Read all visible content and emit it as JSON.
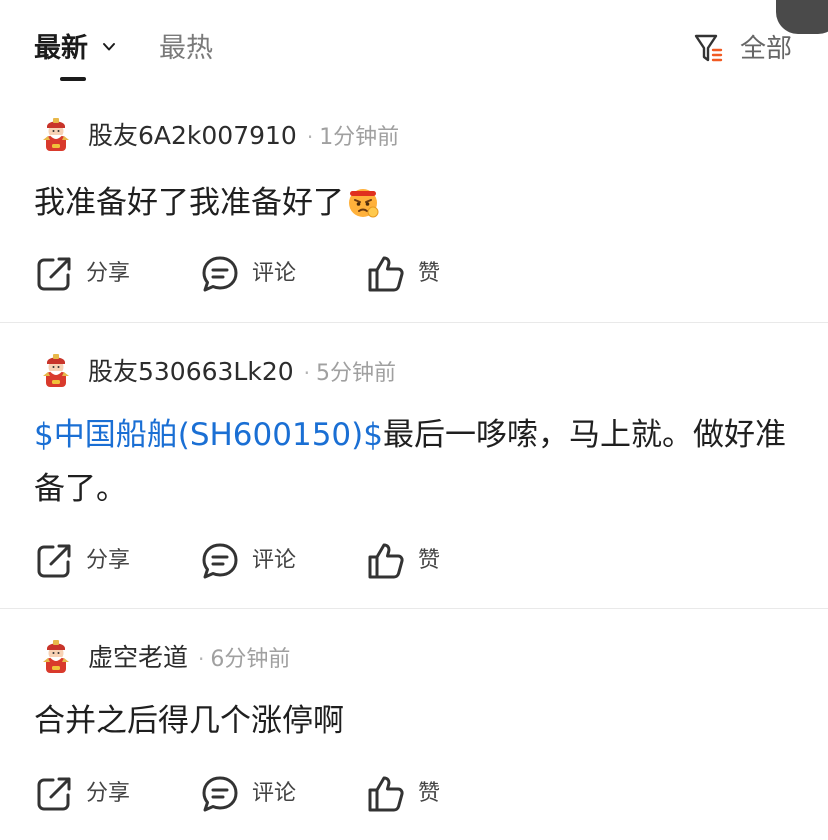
{
  "tabs": {
    "latest": "最新",
    "hot": "最热",
    "filter_label": "全部"
  },
  "icons": {
    "chevron": "chevron-down-icon",
    "filter": "filter-icon",
    "share": "share-icon",
    "comment": "comment-icon",
    "like": "thumbs-up-icon",
    "avatar": "god-of-wealth-avatar",
    "emoji": "angry-face-emoji"
  },
  "colors": {
    "link": "#1a6fd4",
    "filter_accent": "#f15a22"
  },
  "posts": [
    {
      "username": "股友6A2k007910",
      "time": "1分钟前",
      "text": "我准备好了我准备好了"
    },
    {
      "username": "股友530663Lk20",
      "time": "5分钟前",
      "stock_link": "$中国船舶(SH600150)$",
      "text": "最后一哆嗦，马上就。做好准备了。"
    },
    {
      "username": "虚空老道",
      "time": "6分钟前",
      "text": "合并之后得几个涨停啊"
    }
  ],
  "actions": {
    "share": "分享",
    "comment": "评论",
    "like": "赞"
  }
}
